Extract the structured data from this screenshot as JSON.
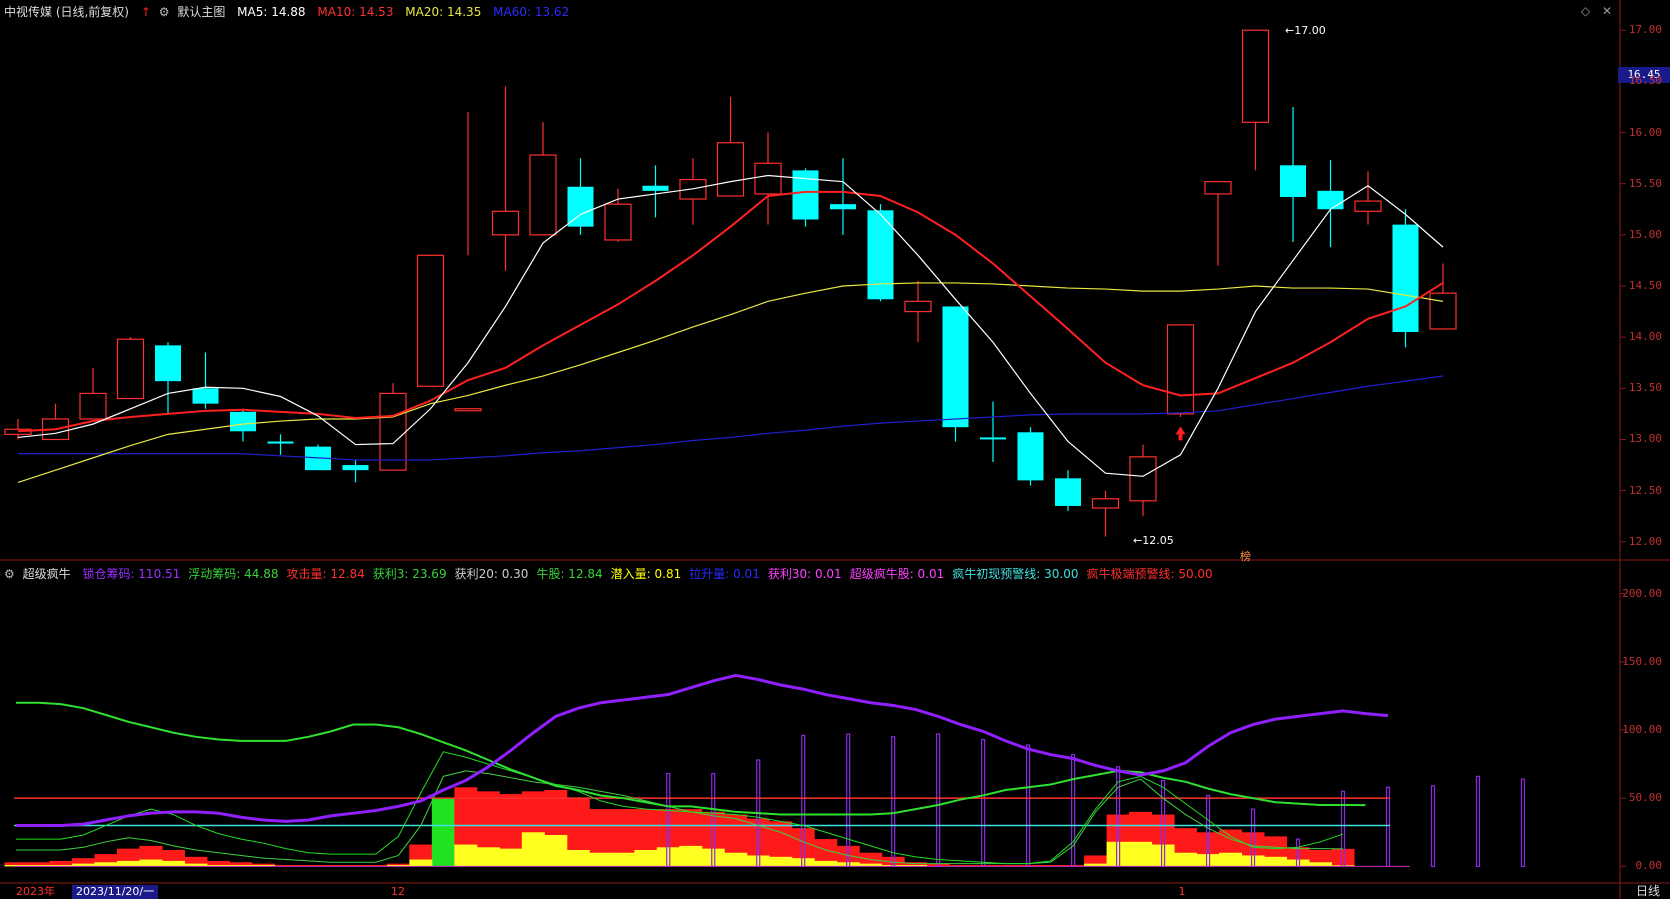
{
  "header": {
    "stock_title": "中视传媒 (日线,前复权)",
    "main_chart_label": "默认主图",
    "ma5": "MA5: 14.88",
    "ma10": "MA10: 14.53",
    "ma20": "MA20: 14.35",
    "ma60": "MA60: 13.62"
  },
  "sub_header": {
    "indicator_name": "超级疯牛",
    "items": [
      {
        "text": "锁仓筹码: 110.51",
        "color": "#9b30ff"
      },
      {
        "text": "浮动筹码: 44.88",
        "color": "#3ad23a"
      },
      {
        "text": "攻击量: 12.84",
        "color": "#ff3030"
      },
      {
        "text": "获利3: 23.69",
        "color": "#3ad23a"
      },
      {
        "text": "获利20: 0.30",
        "color": "#cccccc"
      },
      {
        "text": "牛股: 12.84",
        "color": "#3ad23a"
      },
      {
        "text": "潜入量: 0.81",
        "color": "#ffff00"
      },
      {
        "text": "拉升量: 0.01",
        "color": "#2a2aff"
      },
      {
        "text": "获利30: 0.01",
        "color": "#ff40ff"
      },
      {
        "text": "超级疯牛股: 0.01",
        "color": "#ff40ff"
      },
      {
        "text": "疯牛初现预警线: 30.00",
        "color": "#40e0e0"
      },
      {
        "text": "疯牛极端预警线: 50.00",
        "color": "#ff3030"
      }
    ]
  },
  "price_tag": "16.45",
  "annotations": {
    "high": "17.00",
    "low": "12.05",
    "badge": "榜"
  },
  "period_label": "日线",
  "dates": [
    {
      "label": "2023年",
      "idx": 0
    },
    {
      "label": "2023/11/20/一",
      "idx": 1.5
    },
    {
      "label": "12",
      "idx": 10
    },
    {
      "label": "1",
      "idx": 31
    }
  ],
  "colors": {
    "up": "#ff3030",
    "down": "#00ffff",
    "ma5": "#ffffff",
    "ma10": "#ff2020",
    "ma20": "#e8e840",
    "ma60": "#2020d0"
  },
  "chart_data": [
    {
      "type": "candlestick",
      "title": "中视传媒 (日线,前复权)",
      "ylim": [
        11.9,
        17.1
      ],
      "y_ticks": [
        12.0,
        12.5,
        13.0,
        13.5,
        14.0,
        14.5,
        15.0,
        15.5,
        16.0,
        16.5,
        17.0
      ],
      "candles": [
        {
          "o": 13.05,
          "h": 13.2,
          "l": 13.0,
          "c": 13.1
        },
        {
          "o": 13.0,
          "h": 13.35,
          "l": 13.0,
          "c": 13.2
        },
        {
          "o": 13.2,
          "h": 13.7,
          "l": 13.2,
          "c": 13.45
        },
        {
          "o": 13.4,
          "h": 14.0,
          "l": 13.4,
          "c": 13.98
        },
        {
          "o": 13.92,
          "h": 13.95,
          "l": 13.25,
          "c": 13.57
        },
        {
          "o": 13.5,
          "h": 13.85,
          "l": 13.3,
          "c": 13.35
        },
        {
          "o": 13.27,
          "h": 13.3,
          "l": 12.98,
          "c": 13.08
        },
        {
          "o": 12.98,
          "h": 13.05,
          "l": 12.85,
          "c": 12.96
        },
        {
          "o": 12.93,
          "h": 12.95,
          "l": 12.7,
          "c": 12.7
        },
        {
          "o": 12.75,
          "h": 12.8,
          "l": 12.58,
          "c": 12.7
        },
        {
          "o": 12.7,
          "h": 13.55,
          "l": 12.7,
          "c": 13.45
        },
        {
          "o": 13.52,
          "h": 14.8,
          "l": 13.52,
          "c": 14.8
        },
        {
          "o": 13.3,
          "h": 16.2,
          "l": 14.8,
          "c": 13.3
        },
        {
          "o": 15.0,
          "h": 16.45,
          "l": 14.65,
          "c": 15.23
        },
        {
          "o": 15.0,
          "h": 16.1,
          "l": 15.0,
          "c": 15.78
        },
        {
          "o": 15.47,
          "h": 15.75,
          "l": 15.0,
          "c": 15.08
        },
        {
          "o": 14.95,
          "h": 15.45,
          "l": 14.93,
          "c": 15.3
        },
        {
          "o": 15.48,
          "h": 15.68,
          "l": 15.17,
          "c": 15.43
        },
        {
          "o": 15.35,
          "h": 15.75,
          "l": 15.1,
          "c": 15.54
        },
        {
          "o": 15.38,
          "h": 16.35,
          "l": 15.38,
          "c": 15.9
        },
        {
          "o": 15.4,
          "h": 16.0,
          "l": 15.1,
          "c": 15.7
        },
        {
          "o": 15.63,
          "h": 15.65,
          "l": 15.08,
          "c": 15.15
        },
        {
          "o": 15.3,
          "h": 15.75,
          "l": 15.0,
          "c": 15.25
        },
        {
          "o": 15.24,
          "h": 15.3,
          "l": 14.35,
          "c": 14.37
        },
        {
          "o": 14.25,
          "h": 14.55,
          "l": 13.95,
          "c": 14.35
        },
        {
          "o": 14.3,
          "h": 14.3,
          "l": 12.98,
          "c": 13.12
        },
        {
          "o": 13.02,
          "h": 13.37,
          "l": 12.78,
          "c": 13.01
        },
        {
          "o": 13.07,
          "h": 13.12,
          "l": 12.55,
          "c": 12.6
        },
        {
          "o": 12.62,
          "h": 12.7,
          "l": 12.3,
          "c": 12.35
        },
        {
          "o": 12.33,
          "h": 12.5,
          "l": 12.05,
          "c": 12.42
        },
        {
          "o": 12.4,
          "h": 12.95,
          "l": 12.25,
          "c": 12.83
        },
        {
          "o": 13.25,
          "h": 14.12,
          "l": 13.22,
          "c": 14.12
        },
        {
          "o": 15.4,
          "h": 15.52,
          "l": 14.7,
          "c": 15.52
        },
        {
          "o": 16.1,
          "h": 17.0,
          "l": 15.63,
          "c": 17.0
        },
        {
          "o": 15.68,
          "h": 16.25,
          "l": 14.93,
          "c": 15.37
        },
        {
          "o": 15.43,
          "h": 15.73,
          "l": 14.88,
          "c": 15.25
        },
        {
          "o": 15.23,
          "h": 15.62,
          "l": 15.1,
          "c": 15.33
        },
        {
          "o": 15.1,
          "h": 15.25,
          "l": 13.9,
          "c": 14.05
        },
        {
          "o": 14.08,
          "h": 14.72,
          "l": 14.08,
          "c": 14.43
        }
      ],
      "ma5": [
        13.02,
        13.06,
        13.15,
        13.3,
        13.45,
        13.51,
        13.5,
        13.42,
        13.23,
        12.95,
        12.96,
        13.3,
        13.75,
        14.3,
        14.92,
        15.2,
        15.35,
        15.4,
        15.45,
        15.52,
        15.58,
        15.55,
        15.52,
        15.2,
        14.8,
        14.37,
        13.95,
        13.45,
        12.98,
        12.67,
        12.64,
        12.85,
        13.5,
        14.25,
        14.75,
        15.25,
        15.48,
        15.2,
        14.88
      ],
      "ma10": [
        13.08,
        13.1,
        13.18,
        13.22,
        13.25,
        13.28,
        13.29,
        13.27,
        13.25,
        13.21,
        13.23,
        13.38,
        13.58,
        13.7,
        13.92,
        14.12,
        14.32,
        14.55,
        14.8,
        15.08,
        15.38,
        15.42,
        15.42,
        15.38,
        15.22,
        15.0,
        14.72,
        14.4,
        14.08,
        13.75,
        13.53,
        13.43,
        13.45,
        13.6,
        13.75,
        13.95,
        14.18,
        14.3,
        14.53
      ],
      "ma20": [
        12.58,
        12.7,
        12.82,
        12.94,
        13.05,
        13.1,
        13.15,
        13.18,
        13.2,
        13.2,
        13.22,
        13.35,
        13.43,
        13.53,
        13.62,
        13.73,
        13.85,
        13.97,
        14.1,
        14.22,
        14.35,
        14.43,
        14.5,
        14.52,
        14.53,
        14.53,
        14.52,
        14.5,
        14.48,
        14.47,
        14.45,
        14.45,
        14.47,
        14.5,
        14.48,
        14.48,
        14.47,
        14.41,
        14.35
      ],
      "ma60": [
        12.86,
        12.86,
        12.86,
        12.86,
        12.86,
        12.86,
        12.86,
        12.84,
        12.82,
        12.8,
        12.8,
        12.8,
        12.82,
        12.84,
        12.87,
        12.89,
        12.92,
        12.95,
        12.99,
        13.02,
        13.06,
        13.09,
        13.13,
        13.16,
        13.18,
        13.2,
        13.22,
        13.24,
        13.25,
        13.25,
        13.25,
        13.26,
        13.28,
        13.34,
        13.4,
        13.46,
        13.52,
        13.57,
        13.62
      ]
    },
    {
      "type": "indicator",
      "title": "超级疯牛",
      "ylim": [
        -10,
        210
      ],
      "y_ticks": [
        0.0,
        50.0,
        100.0,
        150.0,
        200.0
      ],
      "lines": {
        "lock": [
          30,
          30,
          30,
          31,
          34,
          37,
          39,
          40,
          40,
          39,
          36,
          34,
          33,
          34,
          37,
          39,
          41,
          44,
          48,
          56,
          63,
          73,
          85,
          98,
          110,
          116,
          120,
          122,
          124,
          126,
          131,
          136,
          140,
          137,
          133,
          130,
          126,
          123,
          120,
          118,
          115,
          110,
          104,
          99,
          92,
          86,
          82,
          79,
          74,
          70,
          67,
          70,
          76,
          88,
          98,
          104,
          108,
          110,
          112,
          114,
          112,
          110.51
        ],
        "float": [
          120,
          120,
          119,
          116,
          111,
          106,
          102,
          98,
          95,
          93,
          92,
          92,
          92,
          95,
          99,
          104,
          104,
          102,
          97,
          91,
          85,
          78,
          71,
          65,
          59,
          56,
          52,
          50,
          47,
          44,
          44,
          42,
          40,
          39,
          38,
          38,
          38,
          38,
          38,
          39,
          42,
          45,
          49,
          52,
          56,
          58,
          60,
          64,
          67,
          70,
          69,
          65,
          62,
          57,
          53,
          50,
          47,
          46,
          45,
          45,
          44.88
        ],
        "profit3": [
          20,
          20,
          20,
          23,
          30,
          37,
          42,
          38,
          30,
          24,
          20,
          17,
          13,
          10,
          9,
          9,
          9,
          22,
          54,
          84,
          80,
          75,
          70,
          65,
          60,
          55,
          48,
          44,
          42,
          41,
          40,
          39,
          38,
          36,
          33,
          30,
          25,
          20,
          15,
          10,
          7,
          5,
          4,
          3,
          2,
          2,
          4,
          18,
          42,
          62,
          66,
          58,
          46,
          34,
          22,
          14,
          13,
          14,
          18,
          23.69
        ],
        "profit20": [
          12,
          12,
          12,
          14,
          18,
          21,
          19,
          15,
          12,
          10,
          8,
          6,
          5,
          4,
          3,
          3,
          3,
          8,
          30,
          66,
          70,
          68,
          65,
          62,
          60,
          58,
          55,
          52,
          48,
          44,
          40,
          37,
          35,
          30,
          25,
          18,
          12,
          8,
          5,
          3,
          2,
          2,
          2,
          2,
          2,
          2,
          3,
          15,
          40,
          58,
          64,
          50,
          38,
          28,
          20,
          15,
          14,
          13,
          13,
          12.84
        ]
      },
      "bars_red": [
        3,
        3,
        4,
        6,
        9,
        13,
        15,
        12,
        7,
        4,
        3,
        2,
        1,
        1,
        1,
        1,
        1,
        2,
        16,
        50,
        58,
        55,
        53,
        55,
        56,
        50,
        42,
        42,
        42,
        42,
        42,
        40,
        38,
        35,
        33,
        28,
        20,
        15,
        10,
        7,
        3,
        2,
        1,
        1,
        1,
        1,
        1,
        1,
        8,
        38,
        40,
        38,
        28,
        25,
        27,
        25,
        22,
        14,
        12,
        12.84
      ],
      "bars_yellow": [
        1,
        1,
        1,
        2,
        3,
        4,
        5,
        4,
        2,
        1,
        1,
        1,
        0,
        0,
        0,
        0,
        0,
        1,
        5,
        15,
        16,
        14,
        13,
        25,
        23,
        12,
        10,
        10,
        12,
        14,
        15,
        13,
        10,
        8,
        7,
        6,
        4,
        3,
        2,
        1,
        1,
        0,
        0,
        0,
        0,
        0,
        0,
        0,
        2,
        18,
        18,
        16,
        10,
        9,
        10,
        8,
        7,
        5,
        3,
        0.81
      ],
      "bars_green_idx": [
        19
      ],
      "spikes_purple": [
        {
          "i": 29,
          "v": 68
        },
        {
          "i": 31,
          "v": 68
        },
        {
          "i": 33,
          "v": 78
        },
        {
          "i": 35,
          "v": 96
        },
        {
          "i": 37,
          "v": 97
        },
        {
          "i": 39,
          "v": 95
        },
        {
          "i": 41,
          "v": 97
        },
        {
          "i": 43,
          "v": 93
        },
        {
          "i": 45,
          "v": 89
        },
        {
          "i": 47,
          "v": 82
        },
        {
          "i": 49,
          "v": 73
        },
        {
          "i": 51,
          "v": 63
        },
        {
          "i": 53,
          "v": 52
        },
        {
          "i": 55,
          "v": 42
        },
        {
          "i": 57,
          "v": 20
        },
        {
          "i": 59,
          "v": 55
        },
        {
          "i": 61,
          "v": 58
        },
        {
          "i": 63,
          "v": 59
        },
        {
          "i": 65,
          "v": 66
        },
        {
          "i": 67,
          "v": 64
        }
      ],
      "ref_lines": [
        {
          "label": "疯牛初现预警线",
          "value": 30,
          "color": "#40e0e0"
        },
        {
          "label": "疯牛极端预警线",
          "value": 50,
          "color": "#ff3030"
        }
      ]
    }
  ]
}
